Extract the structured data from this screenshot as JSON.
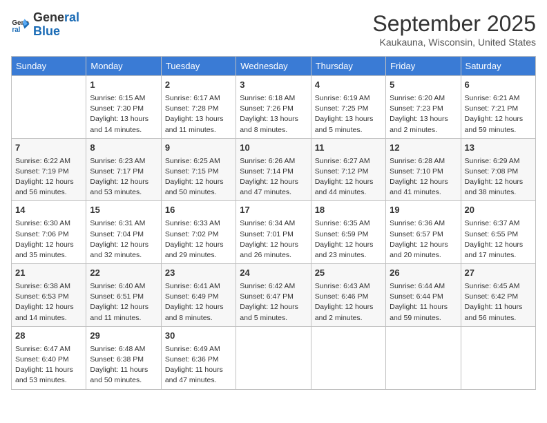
{
  "header": {
    "logo_line1": "General",
    "logo_line2": "Blue",
    "month": "September 2025",
    "location": "Kaukauna, Wisconsin, United States"
  },
  "days_of_week": [
    "Sunday",
    "Monday",
    "Tuesday",
    "Wednesday",
    "Thursday",
    "Friday",
    "Saturday"
  ],
  "weeks": [
    [
      {
        "day": "",
        "info": ""
      },
      {
        "day": "1",
        "info": "Sunrise: 6:15 AM\nSunset: 7:30 PM\nDaylight: 13 hours\nand 14 minutes."
      },
      {
        "day": "2",
        "info": "Sunrise: 6:17 AM\nSunset: 7:28 PM\nDaylight: 13 hours\nand 11 minutes."
      },
      {
        "day": "3",
        "info": "Sunrise: 6:18 AM\nSunset: 7:26 PM\nDaylight: 13 hours\nand 8 minutes."
      },
      {
        "day": "4",
        "info": "Sunrise: 6:19 AM\nSunset: 7:25 PM\nDaylight: 13 hours\nand 5 minutes."
      },
      {
        "day": "5",
        "info": "Sunrise: 6:20 AM\nSunset: 7:23 PM\nDaylight: 13 hours\nand 2 minutes."
      },
      {
        "day": "6",
        "info": "Sunrise: 6:21 AM\nSunset: 7:21 PM\nDaylight: 12 hours\nand 59 minutes."
      }
    ],
    [
      {
        "day": "7",
        "info": "Sunrise: 6:22 AM\nSunset: 7:19 PM\nDaylight: 12 hours\nand 56 minutes."
      },
      {
        "day": "8",
        "info": "Sunrise: 6:23 AM\nSunset: 7:17 PM\nDaylight: 12 hours\nand 53 minutes."
      },
      {
        "day": "9",
        "info": "Sunrise: 6:25 AM\nSunset: 7:15 PM\nDaylight: 12 hours\nand 50 minutes."
      },
      {
        "day": "10",
        "info": "Sunrise: 6:26 AM\nSunset: 7:14 PM\nDaylight: 12 hours\nand 47 minutes."
      },
      {
        "day": "11",
        "info": "Sunrise: 6:27 AM\nSunset: 7:12 PM\nDaylight: 12 hours\nand 44 minutes."
      },
      {
        "day": "12",
        "info": "Sunrise: 6:28 AM\nSunset: 7:10 PM\nDaylight: 12 hours\nand 41 minutes."
      },
      {
        "day": "13",
        "info": "Sunrise: 6:29 AM\nSunset: 7:08 PM\nDaylight: 12 hours\nand 38 minutes."
      }
    ],
    [
      {
        "day": "14",
        "info": "Sunrise: 6:30 AM\nSunset: 7:06 PM\nDaylight: 12 hours\nand 35 minutes."
      },
      {
        "day": "15",
        "info": "Sunrise: 6:31 AM\nSunset: 7:04 PM\nDaylight: 12 hours\nand 32 minutes."
      },
      {
        "day": "16",
        "info": "Sunrise: 6:33 AM\nSunset: 7:02 PM\nDaylight: 12 hours\nand 29 minutes."
      },
      {
        "day": "17",
        "info": "Sunrise: 6:34 AM\nSunset: 7:01 PM\nDaylight: 12 hours\nand 26 minutes."
      },
      {
        "day": "18",
        "info": "Sunrise: 6:35 AM\nSunset: 6:59 PM\nDaylight: 12 hours\nand 23 minutes."
      },
      {
        "day": "19",
        "info": "Sunrise: 6:36 AM\nSunset: 6:57 PM\nDaylight: 12 hours\nand 20 minutes."
      },
      {
        "day": "20",
        "info": "Sunrise: 6:37 AM\nSunset: 6:55 PM\nDaylight: 12 hours\nand 17 minutes."
      }
    ],
    [
      {
        "day": "21",
        "info": "Sunrise: 6:38 AM\nSunset: 6:53 PM\nDaylight: 12 hours\nand 14 minutes."
      },
      {
        "day": "22",
        "info": "Sunrise: 6:40 AM\nSunset: 6:51 PM\nDaylight: 12 hours\nand 11 minutes."
      },
      {
        "day": "23",
        "info": "Sunrise: 6:41 AM\nSunset: 6:49 PM\nDaylight: 12 hours\nand 8 minutes."
      },
      {
        "day": "24",
        "info": "Sunrise: 6:42 AM\nSunset: 6:47 PM\nDaylight: 12 hours\nand 5 minutes."
      },
      {
        "day": "25",
        "info": "Sunrise: 6:43 AM\nSunset: 6:46 PM\nDaylight: 12 hours\nand 2 minutes."
      },
      {
        "day": "26",
        "info": "Sunrise: 6:44 AM\nSunset: 6:44 PM\nDaylight: 11 hours\nand 59 minutes."
      },
      {
        "day": "27",
        "info": "Sunrise: 6:45 AM\nSunset: 6:42 PM\nDaylight: 11 hours\nand 56 minutes."
      }
    ],
    [
      {
        "day": "28",
        "info": "Sunrise: 6:47 AM\nSunset: 6:40 PM\nDaylight: 11 hours\nand 53 minutes."
      },
      {
        "day": "29",
        "info": "Sunrise: 6:48 AM\nSunset: 6:38 PM\nDaylight: 11 hours\nand 50 minutes."
      },
      {
        "day": "30",
        "info": "Sunrise: 6:49 AM\nSunset: 6:36 PM\nDaylight: 11 hours\nand 47 minutes."
      },
      {
        "day": "",
        "info": ""
      },
      {
        "day": "",
        "info": ""
      },
      {
        "day": "",
        "info": ""
      },
      {
        "day": "",
        "info": ""
      }
    ]
  ]
}
